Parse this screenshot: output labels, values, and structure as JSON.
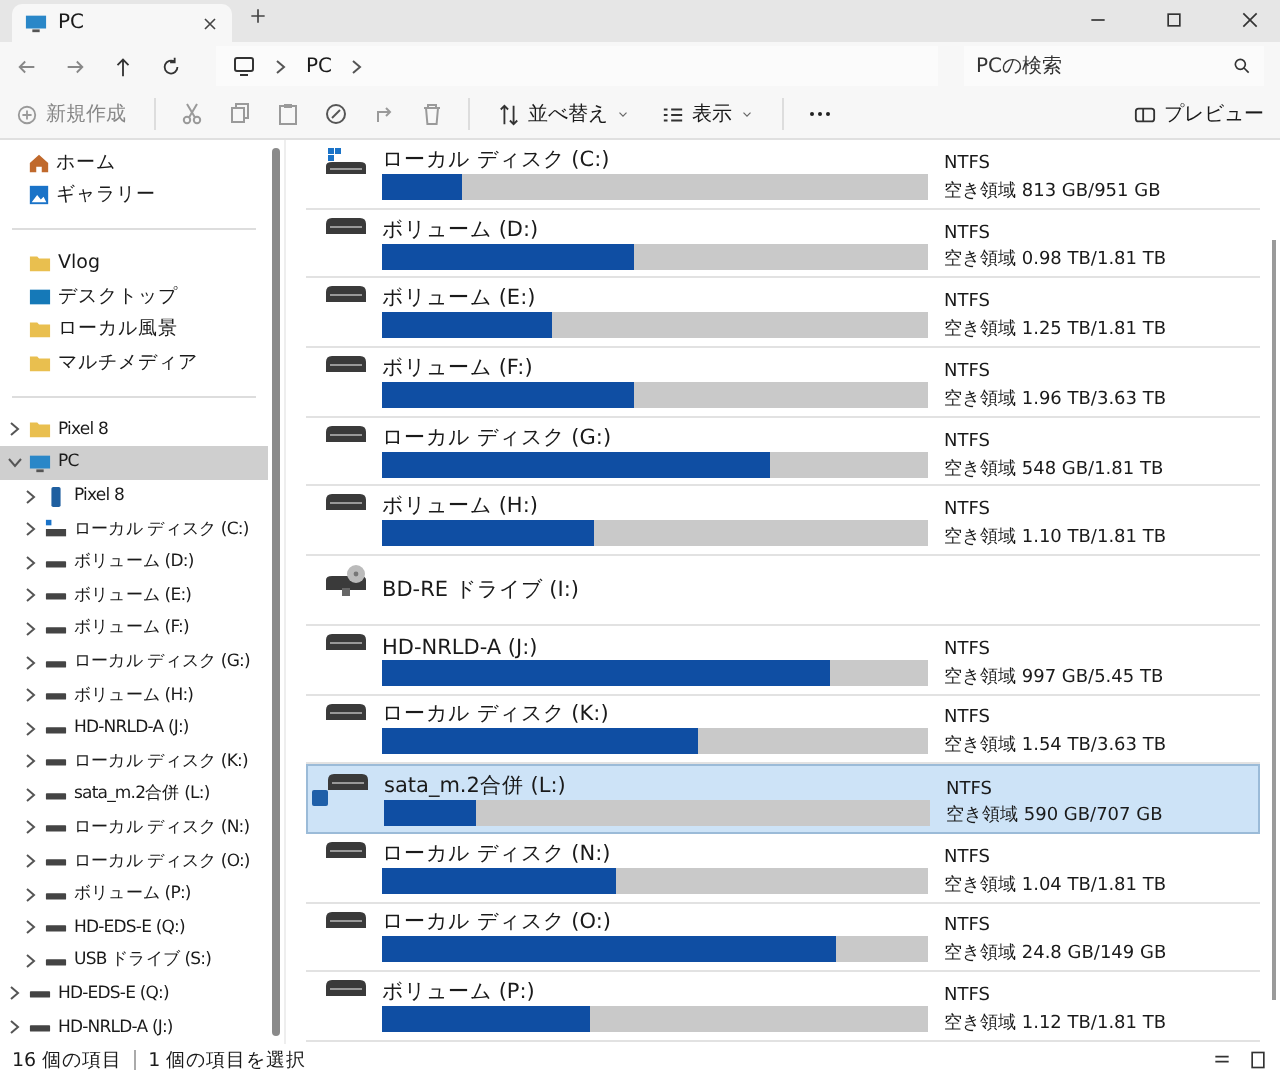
{
  "window": {
    "tab_title": "PC"
  },
  "address": {
    "path": "PC",
    "search_placeholder": "PCの検索"
  },
  "toolbar": {
    "new_item": {
      "label": "新規作成",
      "disabled": true
    },
    "sort": {
      "label": "並べ替え"
    },
    "view": {
      "label": "表示"
    },
    "preview": {
      "label": "プレビュー"
    }
  },
  "quick_access": [
    {
      "label": "ホーム",
      "kind": "home"
    },
    {
      "label": "ギャラリー",
      "kind": "gallery"
    }
  ],
  "pinned": [
    {
      "label": "Vlog",
      "kind": "folder"
    },
    {
      "label": "デスクトップ",
      "kind": "desktop"
    },
    {
      "label": "ローカル風景",
      "kind": "folder"
    },
    {
      "label": "マルチメディア",
      "kind": "folder"
    }
  ],
  "tree": [
    {
      "label": "Pixel 8",
      "kind": "folder",
      "expanded": false,
      "selected": false
    },
    {
      "label": "PC",
      "kind": "pc",
      "expanded": true,
      "selected": true,
      "children": [
        {
          "label": "Pixel 8",
          "kind": "phone",
          "expanded": false,
          "selected": false
        },
        {
          "label": "ローカル ディスク (C:)",
          "kind": "system",
          "expanded": false,
          "selected": false
        },
        {
          "label": "ボリューム (D:)",
          "kind": "disk",
          "expanded": false,
          "selected": false
        },
        {
          "label": "ボリューム (E:)",
          "kind": "disk",
          "expanded": false,
          "selected": false
        },
        {
          "label": "ボリューム (F:)",
          "kind": "disk",
          "expanded": false,
          "selected": false
        },
        {
          "label": "ローカル ディスク (G:)",
          "kind": "disk",
          "expanded": false,
          "selected": false
        },
        {
          "label": "ボリューム (H:)",
          "kind": "disk",
          "expanded": false,
          "selected": false
        },
        {
          "label": "HD-NRLD-A (J:)",
          "kind": "disk",
          "expanded": false,
          "selected": false
        },
        {
          "label": "ローカル ディスク (K:)",
          "kind": "disk",
          "expanded": false,
          "selected": false
        },
        {
          "label": "sata_m.2合併 (L:)",
          "kind": "disk",
          "expanded": false,
          "selected": false
        },
        {
          "label": "ローカル ディスク (N:)",
          "kind": "disk",
          "expanded": false,
          "selected": false
        },
        {
          "label": "ローカル ディスク (O:)",
          "kind": "disk",
          "expanded": false,
          "selected": false
        },
        {
          "label": "ボリューム (P:)",
          "kind": "disk",
          "expanded": false,
          "selected": false
        },
        {
          "label": "HD-EDS-E (Q:)",
          "kind": "disk",
          "expanded": false,
          "selected": false
        },
        {
          "label": "USB ドライブ (S:)",
          "kind": "disk",
          "expanded": false,
          "selected": false
        }
      ]
    },
    {
      "label": "HD-EDS-E (Q:)",
      "kind": "disk",
      "expanded": false,
      "selected": false
    },
    {
      "label": "HD-NRLD-A (J:)",
      "kind": "disk",
      "expanded": false,
      "selected": false
    }
  ],
  "drives": [
    {
      "name": "ローカル ディスク (C:)",
      "kind": "system",
      "filesystem": "NTFS",
      "free_space": "空き領域 813 GB/951 GB",
      "level": 0.145,
      "selected": false
    },
    {
      "name": "ボリューム (D:)",
      "kind": "disk",
      "filesystem": "NTFS",
      "free_space": "空き領域 0.98 TB/1.81 TB",
      "level": 0.46,
      "selected": false
    },
    {
      "name": "ボリューム (E:)",
      "kind": "disk",
      "filesystem": "NTFS",
      "free_space": "空き領域 1.25 TB/1.81 TB",
      "level": 0.31,
      "selected": false
    },
    {
      "name": "ボリューム (F:)",
      "kind": "disk",
      "filesystem": "NTFS",
      "free_space": "空き領域 1.96 TB/3.63 TB",
      "level": 0.46,
      "selected": false
    },
    {
      "name": "ローカル ディスク (G:)",
      "kind": "disk",
      "filesystem": "NTFS",
      "free_space": "空き領域 548 GB/1.81 TB",
      "level": 0.71,
      "selected": false
    },
    {
      "name": "ボリューム (H:)",
      "kind": "disk",
      "filesystem": "NTFS",
      "free_space": "空き領域 1.10 TB/1.81 TB",
      "level": 0.39,
      "selected": false
    },
    {
      "name": "BD-RE ドライブ (I:)",
      "kind": "optical",
      "selected": false
    },
    {
      "name": "HD-NRLD-A (J:)",
      "kind": "disk",
      "filesystem": "NTFS",
      "free_space": "空き領域 997 GB/5.45 TB",
      "level": 0.82,
      "selected": false
    },
    {
      "name": "ローカル ディスク (K:)",
      "kind": "disk",
      "filesystem": "NTFS",
      "free_space": "空き領域 1.54 TB/3.63 TB",
      "level": 0.58,
      "selected": false
    },
    {
      "name": "sata_m.2合併 (L:)",
      "kind": "disk",
      "filesystem": "NTFS",
      "free_space": "空き領域 590 GB/707 GB",
      "level": 0.17,
      "selected": true
    },
    {
      "name": "ローカル ディスク (N:)",
      "kind": "disk",
      "filesystem": "NTFS",
      "free_space": "空き領域 1.04 TB/1.81 TB",
      "level": 0.43,
      "selected": false
    },
    {
      "name": "ローカル ディスク (O:)",
      "kind": "disk",
      "filesystem": "NTFS",
      "free_space": "空き領域 24.8 GB/149 GB",
      "level": 0.83,
      "selected": false
    },
    {
      "name": "ボリューム (P:)",
      "kind": "disk",
      "filesystem": "NTFS",
      "free_space": "空き領域 1.12 TB/1.81 TB",
      "level": 0.38,
      "selected": false
    }
  ],
  "status_bar": {
    "item_count": "16 個の項目",
    "selection": "1 個の項目を選択"
  }
}
